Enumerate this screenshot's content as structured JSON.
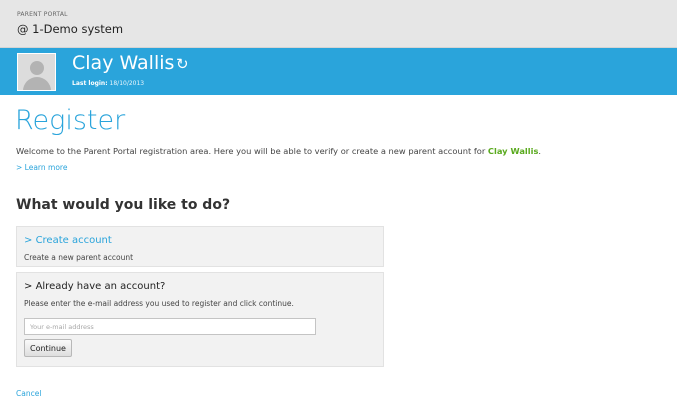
{
  "header": {
    "portal_label": "PARENT PORTAL",
    "system_name": "@ 1-Demo system"
  },
  "user": {
    "name": "Clay Wallis",
    "refresh_icon": "refresh-icon",
    "last_login_label": "Last login:",
    "last_login_date": "18/10/2013"
  },
  "register": {
    "title": "Register",
    "intro_text": "Welcome to the Parent Portal registration area. Here you will be able to verify or create a new parent account for",
    "child_name": "Clay Wallis",
    "intro_end": ".",
    "learn_more": "> Learn more"
  },
  "options": {
    "title": "What would you like to do?",
    "create": {
      "prefix": "> ",
      "heading": "Create account",
      "description": "Create a new parent account"
    },
    "existing": {
      "prefix": "> ",
      "heading": "Already have an account?",
      "description": "Please enter the e-mail address you used to register and click continue.",
      "email_placeholder": "Your e-mail address",
      "email_value": "",
      "continue_label": "Continue"
    }
  },
  "footer": {
    "cancel_label": "Cancel"
  },
  "colors": {
    "accent": "#2aa4db",
    "child_name": "#5aaa1e",
    "topbar": "#e6e6e6",
    "panel": "#f2f2f2"
  }
}
